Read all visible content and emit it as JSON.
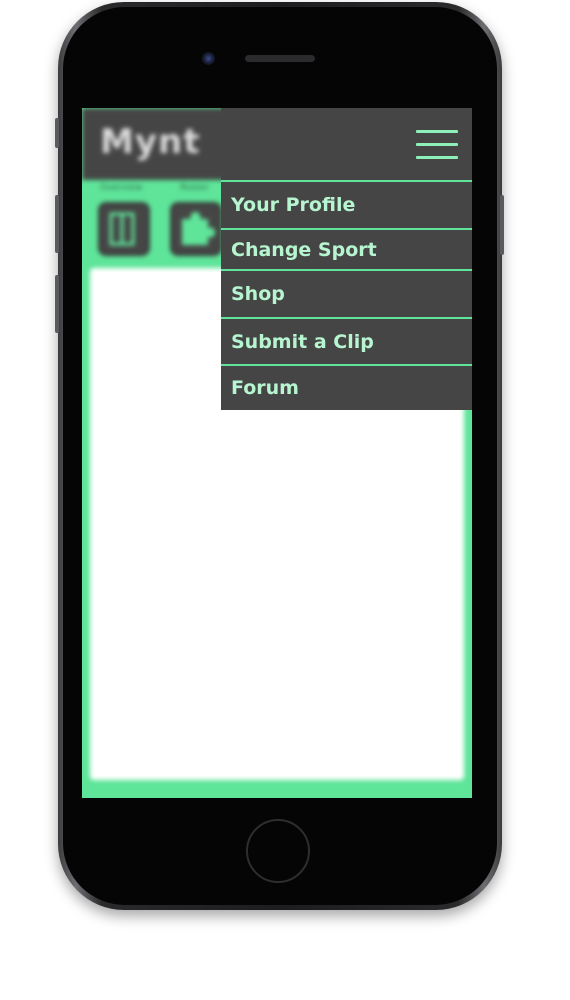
{
  "app": {
    "logo_text": "Mynt",
    "tabs": [
      "Overview",
      "Roster"
    ]
  },
  "menu": {
    "toggle_icon": "hamburger-icon",
    "items": [
      {
        "label": "Your Profile"
      },
      {
        "label": "Change Sport"
      },
      {
        "label": "Shop"
      },
      {
        "label": "Submit a Clip"
      },
      {
        "label": "Forum"
      }
    ]
  },
  "colors": {
    "accent": "#5fe59a",
    "menu_bg": "#454545",
    "menu_text": "#b6f5cf",
    "device_body": "#1d1d1f"
  }
}
